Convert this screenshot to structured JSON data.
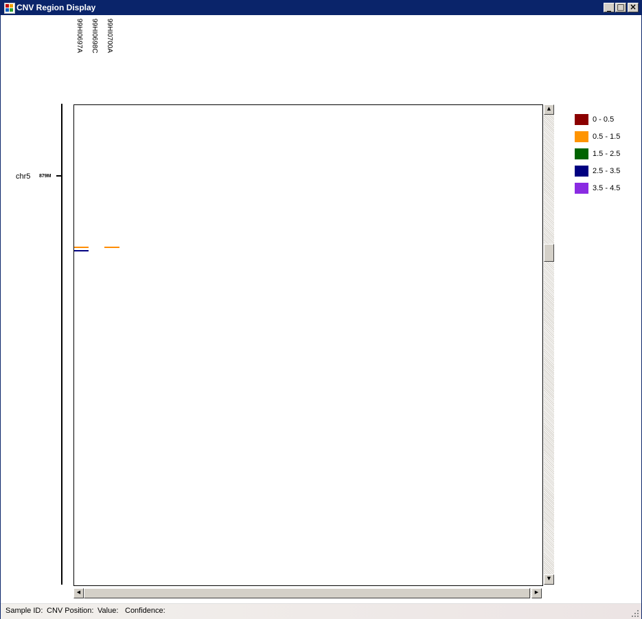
{
  "window": {
    "title": "CNV Region Display"
  },
  "titlebar_buttons": {
    "minimize": "_",
    "maximize": "□",
    "close": "×"
  },
  "samples": [
    "99HI0697A",
    "99HI0698C",
    "99HI0700A"
  ],
  "chromosome": {
    "label": "chr5",
    "position_label": "879M"
  },
  "cnv_segments": [
    {
      "sample": "99HI0697A",
      "value_range": "0.5 - 1.5",
      "color": "#ff8c00"
    },
    {
      "sample": "99HI0697A",
      "value_range": "2.5 - 3.5",
      "color": "#000080"
    },
    {
      "sample": "99HI0700A",
      "value_range": "0.5 - 1.5",
      "color": "#ff8c00"
    }
  ],
  "legend": [
    {
      "label": "0 - 0.5",
      "color": "#8b0000"
    },
    {
      "label": "0.5 - 1.5",
      "color": "#ff9400"
    },
    {
      "label": "1.5 - 2.5",
      "color": "#006400"
    },
    {
      "label": "2.5 - 3.5",
      "color": "#000080"
    },
    {
      "label": "3.5 - 4.5",
      "color": "#8a2be2"
    }
  ],
  "scrollbars": {
    "up_arrow": "▲",
    "down_arrow": "▼",
    "left_arrow": "◀",
    "right_arrow": "▶"
  },
  "statusbar": {
    "sample_id": "Sample ID:",
    "cnv_position": "CNV Position:",
    "value": "Value:",
    "confidence": "Confidence:"
  }
}
